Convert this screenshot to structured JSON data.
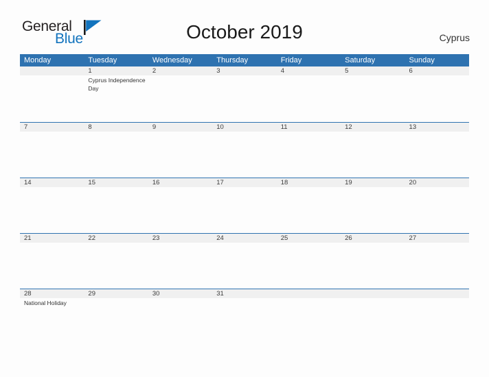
{
  "brand": {
    "name_part1": "General",
    "name_part2": "Blue",
    "flag_icon": "flag-triangle-icon",
    "accent_color": "#1273bd"
  },
  "header": {
    "title": "October 2019",
    "country": "Cyprus"
  },
  "theme": {
    "header_blue": "#2e72b0",
    "daynum_band_gray": "#f0f0f0",
    "page_background": "#fdfdfd",
    "text_dark": "#333333"
  },
  "calendar": {
    "weekdays": [
      "Monday",
      "Tuesday",
      "Wednesday",
      "Thursday",
      "Friday",
      "Saturday",
      "Sunday"
    ],
    "weeks": [
      {
        "days": [
          {
            "num": "",
            "event": ""
          },
          {
            "num": "1",
            "event": "Cyprus Independence Day"
          },
          {
            "num": "2",
            "event": ""
          },
          {
            "num": "3",
            "event": ""
          },
          {
            "num": "4",
            "event": ""
          },
          {
            "num": "5",
            "event": ""
          },
          {
            "num": "6",
            "event": ""
          }
        ]
      },
      {
        "days": [
          {
            "num": "7",
            "event": ""
          },
          {
            "num": "8",
            "event": ""
          },
          {
            "num": "9",
            "event": ""
          },
          {
            "num": "10",
            "event": ""
          },
          {
            "num": "11",
            "event": ""
          },
          {
            "num": "12",
            "event": ""
          },
          {
            "num": "13",
            "event": ""
          }
        ]
      },
      {
        "days": [
          {
            "num": "14",
            "event": ""
          },
          {
            "num": "15",
            "event": ""
          },
          {
            "num": "16",
            "event": ""
          },
          {
            "num": "17",
            "event": ""
          },
          {
            "num": "18",
            "event": ""
          },
          {
            "num": "19",
            "event": ""
          },
          {
            "num": "20",
            "event": ""
          }
        ]
      },
      {
        "days": [
          {
            "num": "21",
            "event": ""
          },
          {
            "num": "22",
            "event": ""
          },
          {
            "num": "23",
            "event": ""
          },
          {
            "num": "24",
            "event": ""
          },
          {
            "num": "25",
            "event": ""
          },
          {
            "num": "26",
            "event": ""
          },
          {
            "num": "27",
            "event": ""
          }
        ]
      },
      {
        "days": [
          {
            "num": "28",
            "event": "National Holiday"
          },
          {
            "num": "29",
            "event": ""
          },
          {
            "num": "30",
            "event": ""
          },
          {
            "num": "31",
            "event": ""
          },
          {
            "num": "",
            "event": ""
          },
          {
            "num": "",
            "event": ""
          },
          {
            "num": "",
            "event": ""
          }
        ]
      }
    ]
  }
}
